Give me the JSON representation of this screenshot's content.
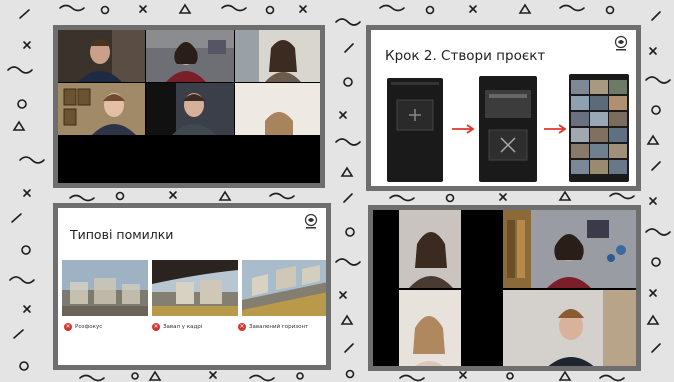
{
  "slides": {
    "step": {
      "title": "Крок 2. Створи проєкт"
    },
    "errors": {
      "title": "Типові помилки",
      "captions": [
        "Розфокус",
        "Завал у кадрі",
        "Завалений горизонт"
      ]
    }
  },
  "icons": {
    "logo": "organization-logo-icon",
    "error": "x-circle-icon",
    "arrow": "arrow-right-icon"
  },
  "colors": {
    "background": "#e4e4e4",
    "panel_border": "#6e6e6e",
    "pattern_stroke": "#1e1e1e",
    "error_red": "#d9342b",
    "arrow_red": "#e0352b"
  }
}
